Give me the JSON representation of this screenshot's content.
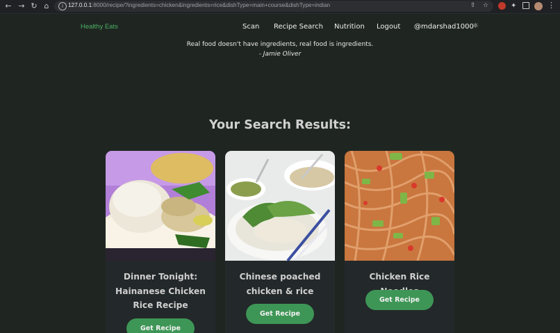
{
  "browser": {
    "url_host": "127.0.0.1",
    "url_rest": ":8000/recipe/?ingredients=chicken&ingredients=rice&dishType=main+course&dishType=indian",
    "nav_icons": [
      "back-icon",
      "forward-icon",
      "reload-icon",
      "home-icon"
    ]
  },
  "navbar": {
    "brand": "Healthy Eats",
    "links": [
      "Scan",
      "Recipe Search",
      "Nutrition",
      "Logout"
    ],
    "user": "@mdarshad1000",
    "brand_color": "#4caf62"
  },
  "quote": {
    "text": "Real food doesn't have ingredients, real food is ingredients.",
    "author": "- Jamie Oliver"
  },
  "results": {
    "heading": "Your Search Results:",
    "button_color": "#3e9656",
    "cards": [
      {
        "title": "Dinner Tonight: Hainanese Chicken Rice Recipe",
        "button": "Get Recipe",
        "image": "hainanese-chicken-rice-photo"
      },
      {
        "title": "Chinese poached chicken & rice",
        "button": "Get Recipe",
        "image": "poached-chicken-rice-photo"
      },
      {
        "title": "Chicken Rice Noodles",
        "button": "Get Recipe",
        "image": "chicken-rice-noodles-photo"
      }
    ]
  }
}
